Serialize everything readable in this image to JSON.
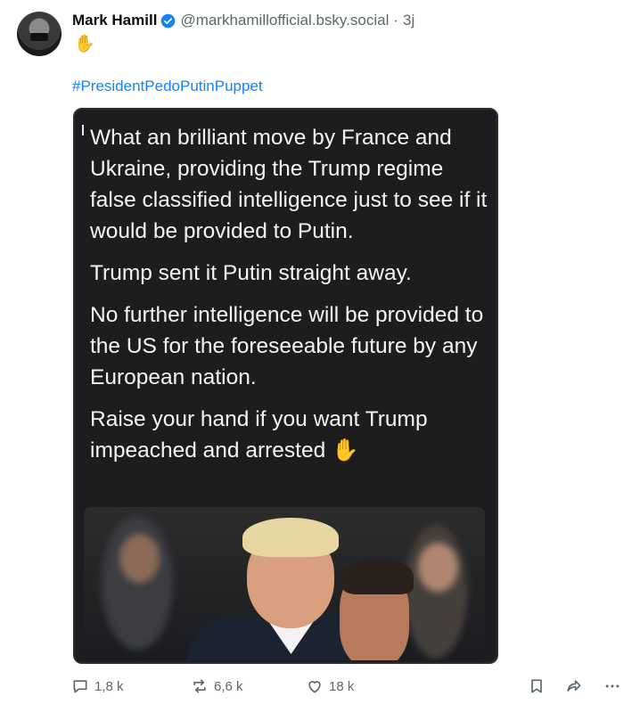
{
  "author": {
    "name": "Mark Hamill",
    "handle": "@markhamillofficial.bsky.social",
    "separator": "·",
    "time": "3j"
  },
  "post": {
    "emoji_line": "✋",
    "hashtag": "#PresidentPedoPutinPuppet"
  },
  "embed": {
    "paragraphs": [
      "What an brilliant move by France and Ukraine, providing the Trump regime false classified intelligence just to see if it would be provided to Putin.",
      "Trump sent it Putin straight away.",
      "No further intelligence will be provided to the US for the foreseeable future by any European nation.",
      "Raise your hand if you want Trump impeached and arrested ✋"
    ]
  },
  "actions": {
    "reply_count": "1,8 k",
    "repost_count": "6,6 k",
    "like_count": "18 k"
  },
  "colors": {
    "link": "#1083fe",
    "verified": "#1083fe",
    "muted": "#5b6670",
    "embed_bg": "#1d1d1f"
  }
}
